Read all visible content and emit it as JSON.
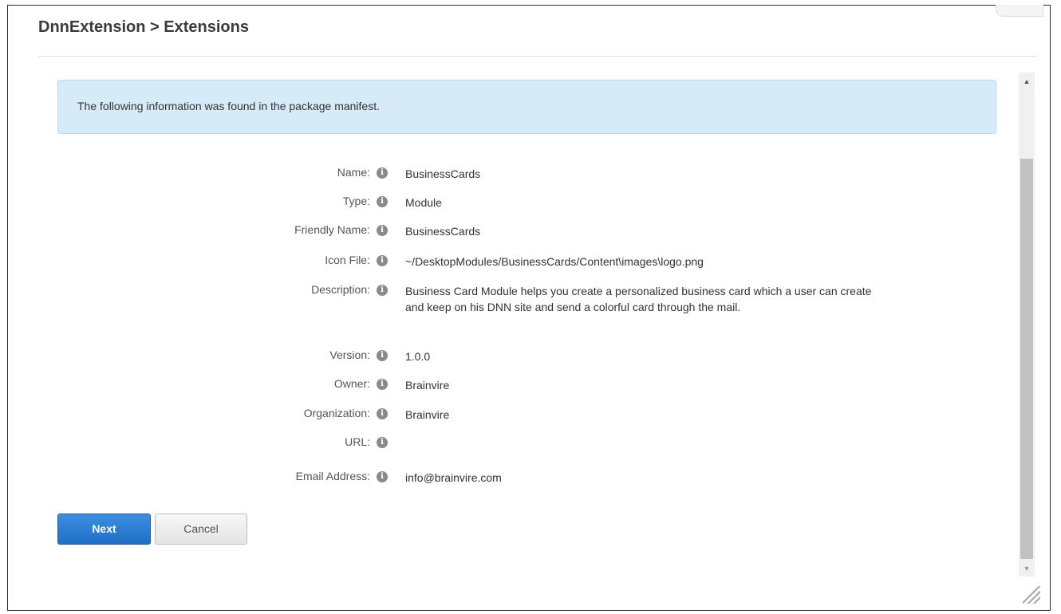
{
  "dialog": {
    "title": "DnnExtension > Extensions"
  },
  "info_message": "The following information was found in the package manifest.",
  "fields": [
    {
      "label": "Name:",
      "value": "BusinessCards"
    },
    {
      "label": "Type:",
      "value": "Module"
    },
    {
      "label": "Friendly Name:",
      "value": "BusinessCards"
    },
    {
      "label": "Icon File:",
      "value": "~/DesktopModules/BusinessCards/Content\\images\\logo.png"
    },
    {
      "label": "Description:",
      "value": "Business Card Module helps you create a personalized business card which a user can create and keep on his DNN site and send a colorful card through the mail."
    },
    {
      "label": "Version:",
      "value": "1.0.0"
    },
    {
      "label": "Owner:",
      "value": "Brainvire"
    },
    {
      "label": "Organization:",
      "value": "Brainvire"
    },
    {
      "label": "URL:",
      "value": ""
    },
    {
      "label": "Email Address:",
      "value": "info@brainvire.com"
    }
  ],
  "info_icon_glyph": "i",
  "buttons": {
    "next": "Next",
    "cancel": "Cancel"
  },
  "scrollbar": {
    "up_glyph": "▲",
    "down_glyph": "▼"
  }
}
